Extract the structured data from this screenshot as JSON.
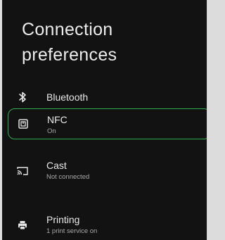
{
  "page": {
    "title": "Connection preferences"
  },
  "items": [
    {
      "label": "Bluetooth",
      "subtitle": "",
      "icon": "bluetooth-icon"
    },
    {
      "label": "NFC",
      "subtitle": "On",
      "icon": "nfc-icon",
      "highlighted": true
    },
    {
      "label": "Cast",
      "subtitle": "Not connected",
      "icon": "cast-icon"
    },
    {
      "label": "Printing",
      "subtitle": "1 print service on",
      "icon": "printer-icon"
    }
  ],
  "colors": {
    "background": "#121212",
    "text_primary": "#eaeaea",
    "text_secondary": "#a9a9a9",
    "highlight_border": "#2fae52"
  }
}
